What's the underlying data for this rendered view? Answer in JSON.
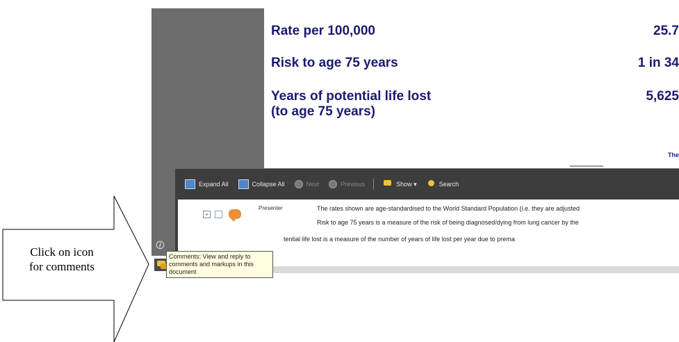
{
  "document": {
    "rows": [
      {
        "label": "Rate per 100,000",
        "value": "25.7"
      },
      {
        "label": "Risk to age 75 years",
        "value": "1 in 34"
      },
      {
        "label_line1": "Years of potential life lost",
        "label_line2": "(to age 75 years)",
        "value": "5,625"
      }
    ],
    "footer_fragment": "The"
  },
  "comments_toolbar": {
    "expand_all": "Expand All",
    "collapse_all": "Collapse All",
    "next": "Next",
    "previous": "Previous",
    "show": "Show ▾",
    "search": "Search"
  },
  "comments_list": {
    "author": "Presenter",
    "lines": [
      "The rates shown are age-standardised to the World Standard Population (i.e. they are adjusted",
      "Risk to age 75 years is a measure of the risk of being diagnosed/dying from lung cancer by the",
      "tential life lost is a measure of the number of years of life lost per year due to prema"
    ]
  },
  "tooltip": {
    "text": "Comments: View and reply to comments and markups in this document"
  },
  "callout": {
    "line1": "Click on icon",
    "line2": "for comments"
  },
  "colors": {
    "doc_text": "#1a1a6e",
    "viewer_bg": "#6c6c6c",
    "panel_bg": "#3d3d3d",
    "tooltip_bg": "#fffde0"
  }
}
